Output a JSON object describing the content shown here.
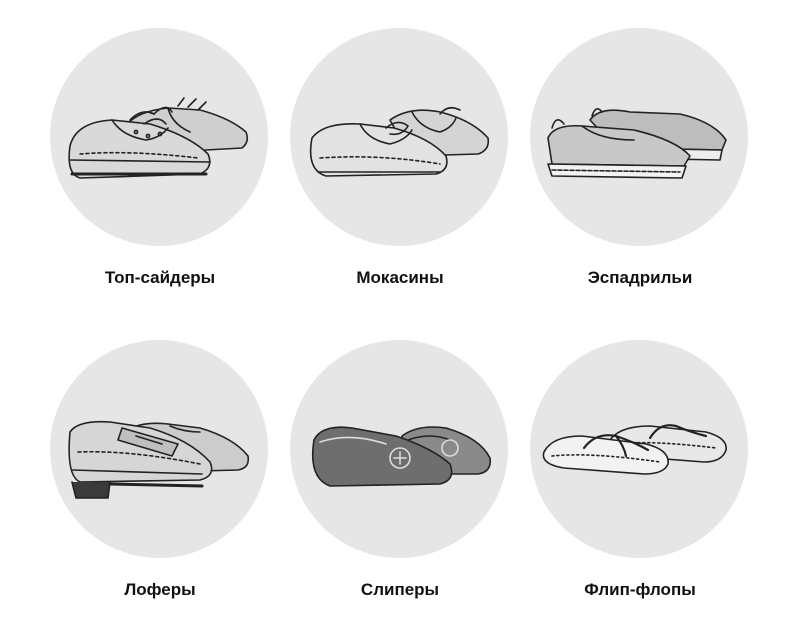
{
  "items": [
    {
      "label": "Топ-сайдеры"
    },
    {
      "label": "Мокасины"
    },
    {
      "label": "Эспадрильи"
    },
    {
      "label": "Лоферы"
    },
    {
      "label": "Слиперы"
    },
    {
      "label": "Флип-флопы"
    }
  ],
  "colors": {
    "circle": "#e6e6e6",
    "ink": "#222222",
    "label": "#111111"
  }
}
